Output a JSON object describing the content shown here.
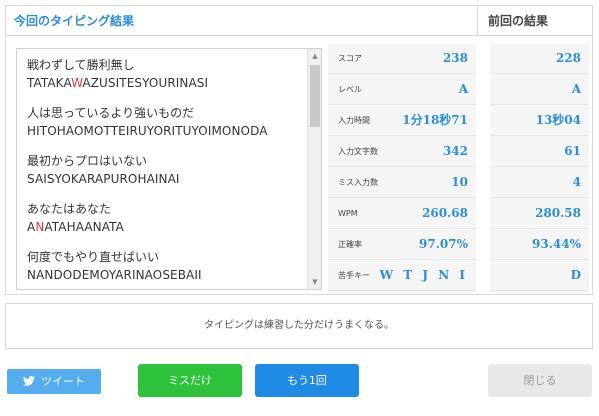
{
  "header": {
    "current_title": "今回のタイピング結果",
    "previous_title": "前回の結果"
  },
  "typed_lines": [
    {
      "jp": "戦わずして勝利無し",
      "romaji_before": "TATAKA",
      "romaji_miss": "W",
      "romaji_after": "AZUSITESYOURINASI"
    },
    {
      "jp": "人は思っているより強いものだ",
      "romaji_before": "HITOHAOMOTTEIRUYORITUYOIMONODA",
      "romaji_miss": "",
      "romaji_after": ""
    },
    {
      "jp": "最初からプロはいない",
      "romaji_before": "SAISYOKARAPUROHAINAI",
      "romaji_miss": "",
      "romaji_after": ""
    },
    {
      "jp": "あなたはあなた",
      "romaji_before": "A",
      "romaji_miss": "N",
      "romaji_after": "ATAHAANATA"
    },
    {
      "jp": "何度でもやり直せばいい",
      "romaji_before": "NANDODEMOYARINAOSEBAII",
      "romaji_miss": "",
      "romaji_after": ""
    }
  ],
  "stats": [
    {
      "label": "スコア",
      "current": "238",
      "previous": "228"
    },
    {
      "label": "レベル",
      "current": "A",
      "previous": "A"
    },
    {
      "label": "入力時間",
      "current": "1分18秒71",
      "previous": "13秒04"
    },
    {
      "label": "入力文字数",
      "current": "342",
      "previous": "61"
    },
    {
      "label": "ミス入力数",
      "current": "10",
      "previous": "4"
    },
    {
      "label": "WPM",
      "current": "260.68",
      "previous": "280.58"
    },
    {
      "label": "正確率",
      "current": "97.07%",
      "previous": "93.44%"
    },
    {
      "label": "苦手キー",
      "current": "W T J N I",
      "previous": "D"
    }
  ],
  "message": "タイピングは練習した分だけうまくなる。",
  "buttons": {
    "tweet": "ツイート",
    "miss_only": "ミスだけ",
    "retry": "もう1回",
    "close": "閉じる"
  },
  "colors": {
    "accent_blue": "#2a8fd6",
    "miss_red": "#e23a3a",
    "tweet_blue": "#55acee",
    "green": "#2cc33a",
    "retry_blue": "#1f8be4"
  }
}
